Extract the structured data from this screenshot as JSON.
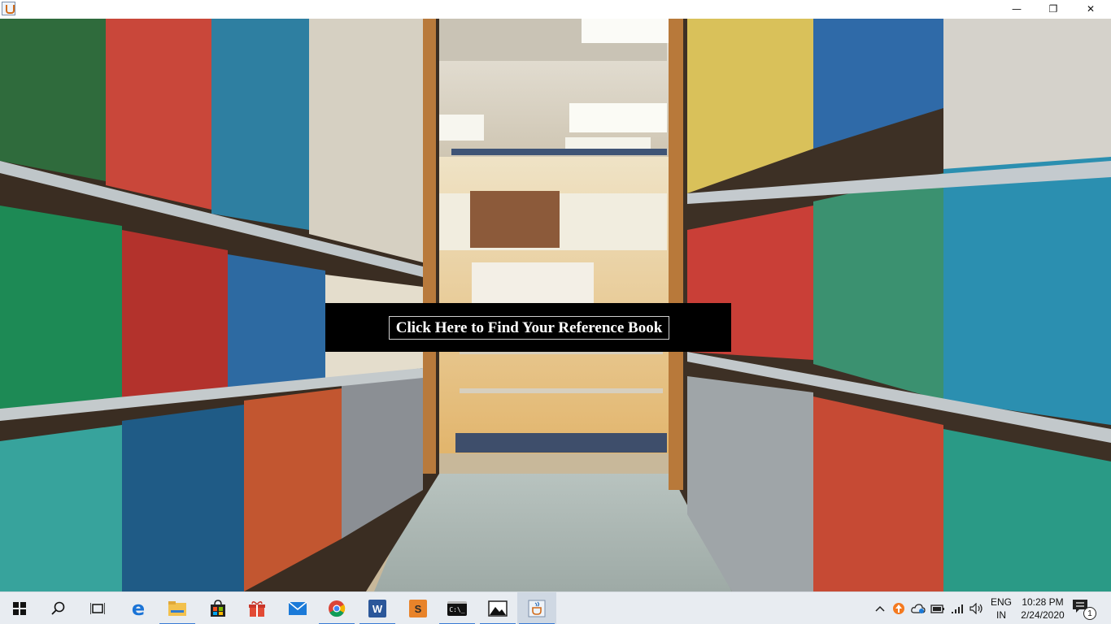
{
  "window": {
    "title_icon": "java-icon",
    "controls": {
      "minimize": "—",
      "maximize": "❐",
      "close": "✕"
    }
  },
  "main": {
    "find_button_label": "Click Here to Find Your Reference Book"
  },
  "taskbar": {
    "items": [
      {
        "name": "start-button",
        "icon": "windows-icon"
      },
      {
        "name": "search-button",
        "icon": "search-icon"
      },
      {
        "name": "task-view-button",
        "icon": "task-view-icon"
      },
      {
        "name": "edge-button",
        "icon": "edge-icon",
        "glyph": "e"
      },
      {
        "name": "file-explorer-button",
        "icon": "folder-icon"
      },
      {
        "name": "store-button",
        "icon": "store-icon"
      },
      {
        "name": "office-button",
        "icon": "gift-icon"
      },
      {
        "name": "mail-button",
        "icon": "mail-icon"
      },
      {
        "name": "chrome-button",
        "icon": "chrome-icon"
      },
      {
        "name": "word-button",
        "icon": "word-icon",
        "glyph": "W"
      },
      {
        "name": "sublime-button",
        "icon": "sublime-icon",
        "glyph": "S"
      },
      {
        "name": "cmd-button",
        "icon": "terminal-icon",
        "glyph": "C:\\_"
      },
      {
        "name": "photos-button",
        "icon": "photos-icon"
      },
      {
        "name": "java-app-button",
        "icon": "java-icon"
      }
    ],
    "tray": {
      "language_line1": "ENG",
      "language_line2": "IN",
      "time": "10:28 PM",
      "date": "2/24/2020",
      "notification_count": "1"
    },
    "accent_color": "#3a7bd5"
  }
}
